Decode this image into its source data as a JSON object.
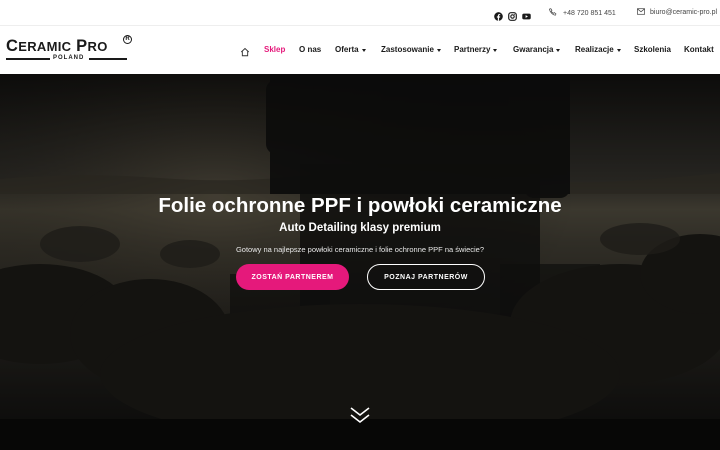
{
  "topbar": {
    "social_icons": [
      "facebook-icon",
      "instagram-icon",
      "youtube-icon"
    ],
    "phone": "+48 720 851 451",
    "email": "biuro@ceramic-pro.pl"
  },
  "logo": {
    "text": "CERAMIC PRO",
    "subtext": "POLAND"
  },
  "nav": {
    "home_icon": "home-icon",
    "items": [
      {
        "label": "Sklep",
        "active": true,
        "dropdown": false
      },
      {
        "label": "O nas",
        "active": false,
        "dropdown": false
      },
      {
        "label": "Oferta",
        "active": false,
        "dropdown": true
      },
      {
        "label": "Zastosowanie",
        "active": false,
        "dropdown": true
      },
      {
        "label": "Partnerzy",
        "active": false,
        "dropdown": true
      },
      {
        "label": "Gwarancja",
        "active": false,
        "dropdown": true
      },
      {
        "label": "Realizacje",
        "active": false,
        "dropdown": true
      },
      {
        "label": "Szkolenia",
        "active": false,
        "dropdown": false
      },
      {
        "label": "Kontakt",
        "active": false,
        "dropdown": false
      }
    ]
  },
  "hero": {
    "title": "Folie ochronne PPF i powłoki ceramiczne",
    "subtitle": "Auto Detailing klasy premium",
    "description": "Gotowy na najlepsze powłoki ceramiczne i folie ochronne PPF na świecie?",
    "primary_button": "ZOSTAŃ PARTNEREM",
    "secondary_button": "POZNAJ PARTNERÓW",
    "scroll_icon": "double-chevron-down-icon"
  },
  "colors": {
    "accent": "#e5197b",
    "text_dark": "#1a1a1a"
  }
}
